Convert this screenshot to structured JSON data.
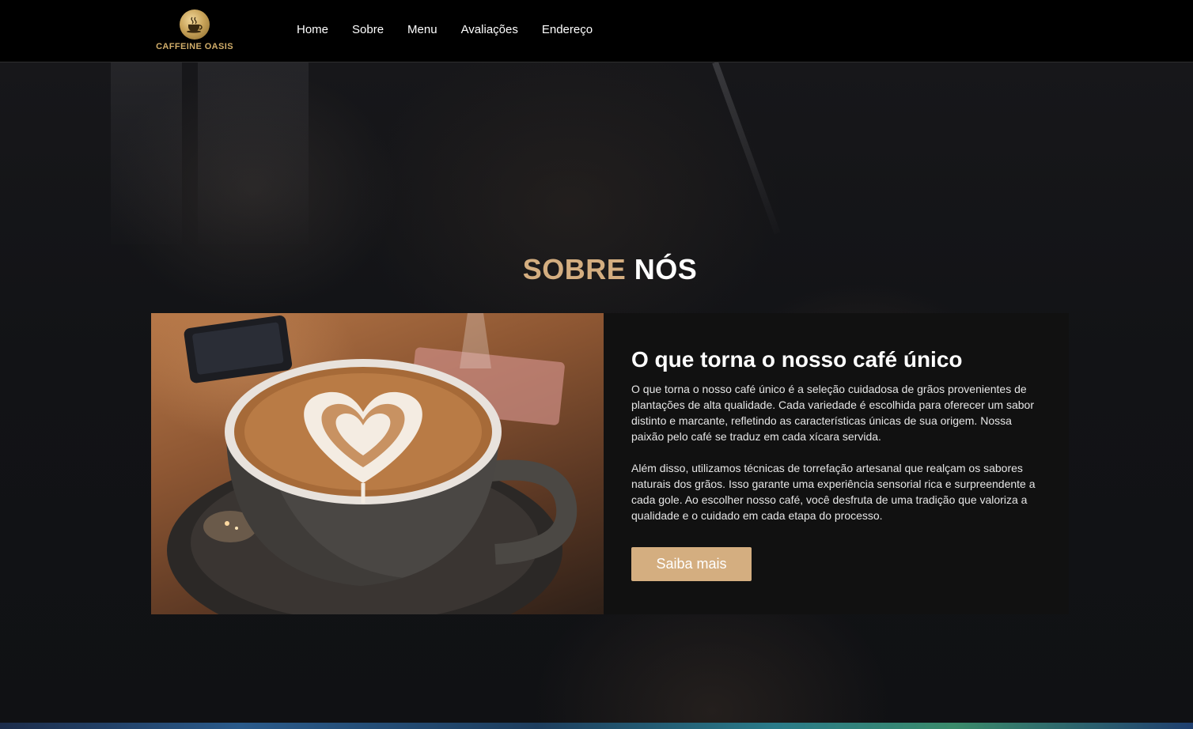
{
  "header": {
    "logo_text": "CAFFEINE OASIS",
    "logo_icon": "coffee-cup-icon",
    "nav": [
      {
        "label": "Home"
      },
      {
        "label": "Sobre"
      },
      {
        "label": "Menu"
      },
      {
        "label": "Avaliações"
      },
      {
        "label": "Endereço"
      }
    ]
  },
  "section": {
    "title_accent": "SOBRE",
    "title_rest": "NÓS"
  },
  "card": {
    "image_subject": "latte-art-coffee-cup",
    "heading": "O que torna o nosso café único",
    "paragraphs": [
      "O que torna o nosso café único é a seleção cuidadosa de grãos provenientes de plantações de alta qualidade. Cada variedade é escolhida para oferecer um sabor distinto e marcante, refletindo as características únicas de sua origem. Nossa paixão pelo café se traduz em cada xícara servida.",
      "Além disso, utilizamos técnicas de torrefação artesanal que realçam os sabores naturais dos grãos. Isso garante uma experiência sensorial rica e surpreendente a cada gole. Ao escolher nosso café, você desfruta de uma tradição que valoriza a qualidade e o cuidado em cada etapa do processo."
    ],
    "button_label": "Saiba mais"
  },
  "colors": {
    "accent": "#d4ae80",
    "header_bg": "#000000",
    "card_bg": "#111111"
  }
}
